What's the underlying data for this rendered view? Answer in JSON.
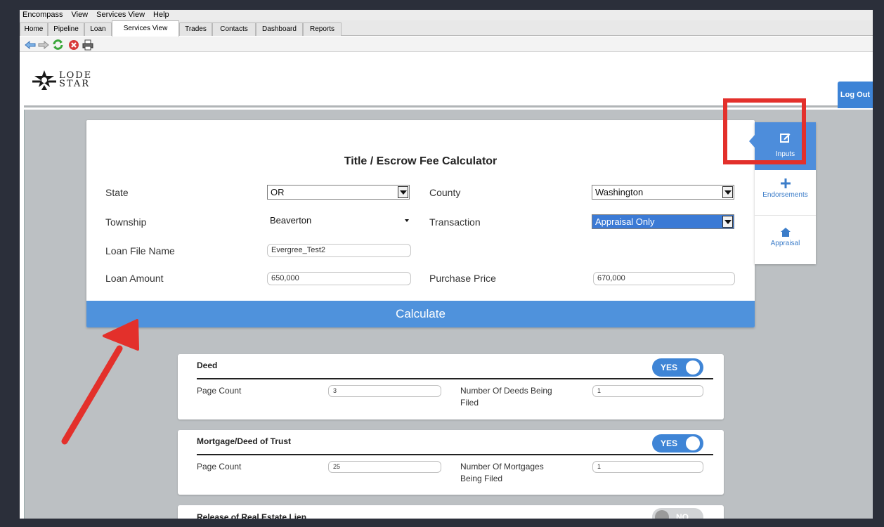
{
  "menubar": [
    "Encompass",
    "View",
    "Services View",
    "Help"
  ],
  "tabs": [
    {
      "label": "Home",
      "active": false
    },
    {
      "label": "Pipeline",
      "active": false
    },
    {
      "label": "Loan",
      "active": false
    },
    {
      "label": "Services View",
      "active": true
    },
    {
      "label": "Trades",
      "active": false
    },
    {
      "label": "Contacts",
      "active": false
    },
    {
      "label": "Dashboard",
      "active": false
    },
    {
      "label": "Reports",
      "active": false
    }
  ],
  "toolbar": {
    "icons": [
      "back-arrow-icon",
      "forward-arrow-icon",
      "refresh-icon",
      "stop-icon",
      "print-icon"
    ]
  },
  "header": {
    "logo_line1": "LODE",
    "logo_line2": "STAR",
    "logout_label": "Log Out"
  },
  "calculator": {
    "title": "Title / Escrow Fee Calculator",
    "state_label": "State",
    "state_value": "OR",
    "county_label": "County",
    "county_value": "Washington",
    "township_label": "Township",
    "township_value": "Beaverton",
    "transaction_label": "Transaction",
    "transaction_value": "Appraisal Only",
    "loan_file_label": "Loan File Name",
    "loan_file_value": "Evergree_Test2",
    "loan_amount_label": "Loan Amount",
    "loan_amount_value": "650,000",
    "purchase_price_label": "Purchase Price",
    "purchase_price_value": "670,000",
    "calculate_label": "Calculate"
  },
  "side_nav": {
    "inputs_label": "Inputs",
    "endorsements_label": "Endorsements",
    "appraisal_label": "Appraisal"
  },
  "sections": {
    "deed": {
      "title": "Deed",
      "toggle": "YES",
      "page_count_label": "Page Count",
      "page_count_value": "3",
      "number_label_1": "Number Of Deeds Being",
      "number_label_2": "Filed",
      "number_value": "1"
    },
    "mortgage": {
      "title": "Mortgage/Deed of Trust",
      "toggle": "YES",
      "page_count_label": "Page Count",
      "page_count_value": "25",
      "number_label_1": "Number Of Mortgages",
      "number_label_2": "Being Filed",
      "number_value": "1"
    },
    "release": {
      "title": "Release of Real Estate Lien",
      "toggle": "NO"
    }
  },
  "colors": {
    "accent": "#4f92dc",
    "highlight_annotation": "#e3302b"
  }
}
